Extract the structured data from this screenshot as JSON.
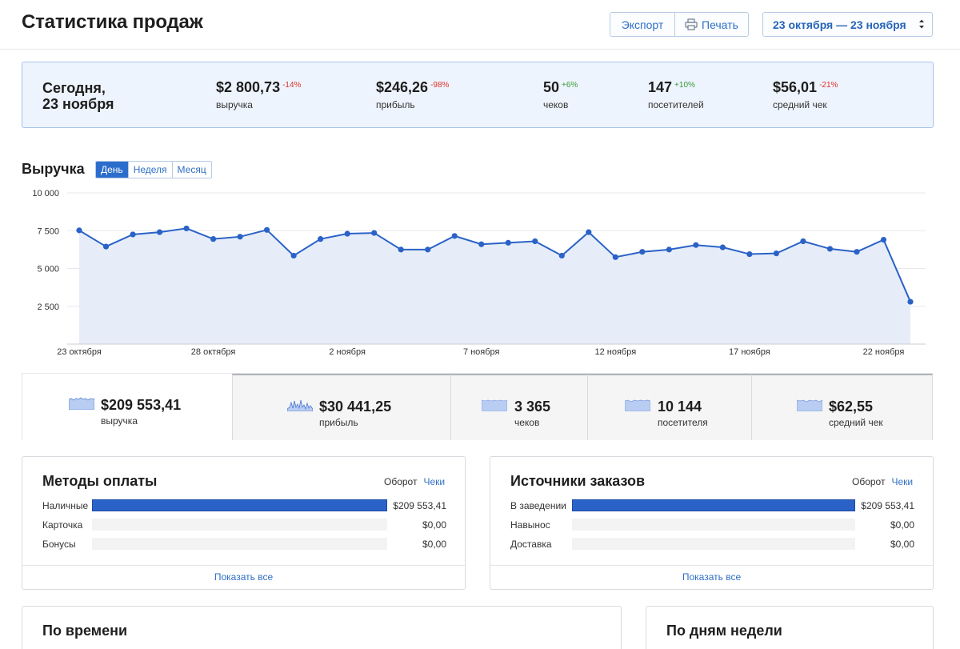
{
  "header": {
    "title": "Статистика продаж",
    "export_label": "Экспорт",
    "print_label": "Печать",
    "date_range": "23 октября — 23 ноября"
  },
  "today": {
    "date_line1": "Сегодня,",
    "date_line2": "23 ноября",
    "kpis": [
      {
        "value": "$2 800,73",
        "change": "-14%",
        "label": "выручка"
      },
      {
        "value": "$246,26",
        "change": "-98%",
        "label": "прибыль"
      },
      {
        "value": "50",
        "change": "+6%",
        "label": "чеков"
      },
      {
        "value": "147",
        "change": "+10%",
        "label": "посетителей"
      },
      {
        "value": "$56,01",
        "change": "-21%",
        "label": "средний чек"
      }
    ]
  },
  "revenue": {
    "title": "Выручка",
    "periods": [
      "День",
      "Неделя",
      "Месяц"
    ],
    "active_period": "День"
  },
  "chart_data": {
    "type": "area",
    "title": "Выручка",
    "x": [
      "23 октября",
      "24 октября",
      "25 октября",
      "26 октября",
      "27 октября",
      "28 октября",
      "29 октября",
      "30 октября",
      "31 октября",
      "1 ноября",
      "2 ноября",
      "3 ноября",
      "4 ноября",
      "5 ноября",
      "6 ноября",
      "7 ноября",
      "8 ноября",
      "9 ноября",
      "10 ноября",
      "11 ноября",
      "12 ноября",
      "13 ноября",
      "14 ноября",
      "15 ноября",
      "16 ноября",
      "17 ноября",
      "18 ноября",
      "19 ноября",
      "20 ноября",
      "21 ноября",
      "22 ноября",
      "23 ноября"
    ],
    "x_tick_labels": [
      "23 октября",
      "28 октября",
      "2 ноября",
      "7 ноября",
      "12 ноября",
      "17 ноября",
      "22 ноября"
    ],
    "series": [
      {
        "values": [
          7520,
          6450,
          7250,
          7400,
          7650,
          6950,
          7100,
          7550,
          5850,
          6950,
          7300,
          7350,
          6250,
          6250,
          7150,
          6600,
          6700,
          6800,
          5850,
          7400,
          5750,
          6100,
          6250,
          6550,
          6400,
          5950,
          6000,
          6800,
          6300,
          6100,
          6900,
          2800
        ],
        "color": "#2b62c7"
      }
    ],
    "y_ticks": [
      "2 500",
      "5 000",
      "7 500",
      "10 000"
    ],
    "ylim": [
      0,
      10000
    ],
    "grid": true,
    "area_fill": "#e6edf8"
  },
  "totals": [
    {
      "value": "$209 553,41",
      "label": "выручка"
    },
    {
      "value": "$30 441,25",
      "label": "прибыль"
    },
    {
      "value": "3 365",
      "label": "чеков"
    },
    {
      "value": "10 144",
      "label": "посетителя"
    },
    {
      "value": "$62,55",
      "label": "средний чек"
    }
  ],
  "payment": {
    "title": "Методы оплаты",
    "switch_static": "Оборот",
    "switch_link": "Чеки",
    "rows": [
      {
        "label": "Наличные",
        "value": "$209 553,41",
        "share": 1.0
      },
      {
        "label": "Карточка",
        "value": "$0,00",
        "share": 0
      },
      {
        "label": "Бонусы",
        "value": "$0,00",
        "share": 0
      }
    ],
    "show_all": "Показать все"
  },
  "sources": {
    "title": "Источники заказов",
    "switch_static": "Оборот",
    "switch_link": "Чеки",
    "rows": [
      {
        "label": "В заведении",
        "value": "$209 553,41",
        "share": 1.0
      },
      {
        "label": "Навынос",
        "value": "$0,00",
        "share": 0
      },
      {
        "label": "Доставка",
        "value": "$0,00",
        "share": 0
      }
    ],
    "show_all": "Показать все"
  },
  "by_time": {
    "title": "По времени"
  },
  "by_weekday": {
    "title": "По дням недели"
  }
}
